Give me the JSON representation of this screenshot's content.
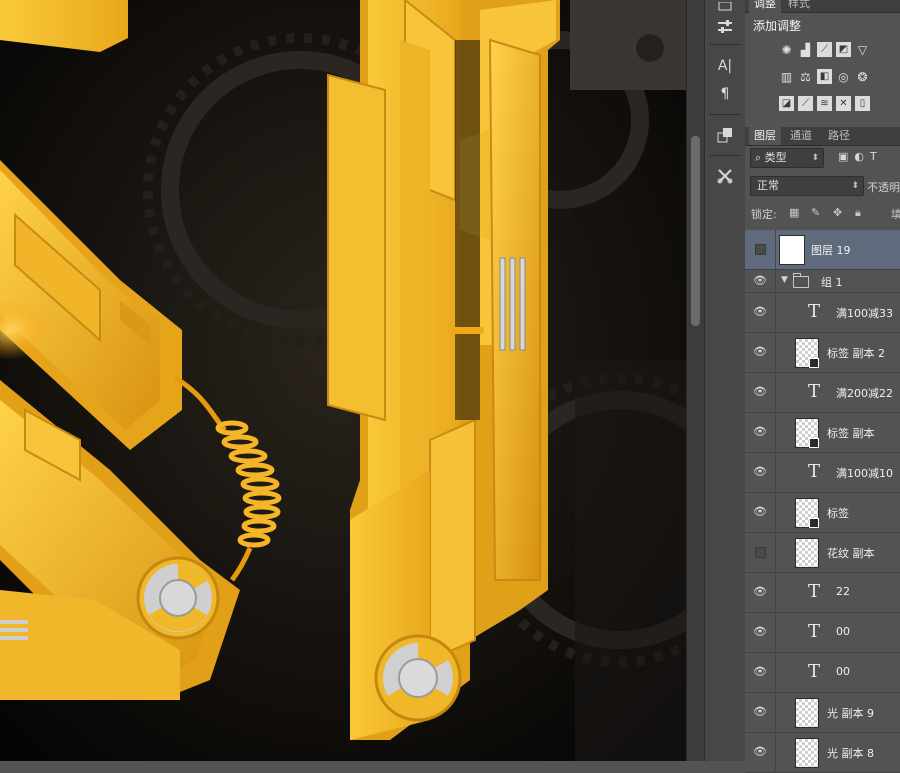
{
  "adjust_panel": {
    "tabs": [
      {
        "label": "调整",
        "active": true
      },
      {
        "label": "样式",
        "active": false
      }
    ],
    "title": "添加调整",
    "rows": [
      [
        "brightness-contrast-icon",
        "levels-icon",
        "curves-icon",
        "exposure-icon",
        "vibrance-icon"
      ],
      [
        "hue-saturation-icon",
        "color-balance-icon",
        "black-white-icon",
        "photo-filter-icon",
        "channel-mixer-icon"
      ],
      [
        "invert-icon",
        "posterize-icon",
        "threshold-icon",
        "gradient-map-icon",
        "selective-color-icon"
      ]
    ]
  },
  "layers_panel": {
    "tabs": [
      {
        "label": "图层",
        "active": true
      },
      {
        "label": "通道",
        "active": false
      },
      {
        "label": "路径",
        "active": false
      }
    ],
    "filter_kind": "类型",
    "filter_icons": [
      "image-filter-icon",
      "adjustment-filter-icon",
      "text-filter-icon"
    ],
    "filter_text_icon": "T",
    "blend_mode": "正常",
    "opacity_label": "不透明",
    "lock_label": "锁定:",
    "layers": [
      {
        "name": "图层 19",
        "kind": "pixel-white",
        "visible": false,
        "selected": true
      },
      {
        "name": "组 1",
        "kind": "group",
        "visible": true,
        "selected": false
      },
      {
        "name": "满100减33",
        "kind": "text",
        "visible": true
      },
      {
        "name": "标签 副本 2",
        "kind": "smart",
        "visible": true
      },
      {
        "name": "满200减22",
        "kind": "text",
        "visible": true
      },
      {
        "name": "标签 副本",
        "kind": "smart",
        "visible": true
      },
      {
        "name": "满100减10",
        "kind": "text",
        "visible": true
      },
      {
        "name": "标签",
        "kind": "smart",
        "visible": true
      },
      {
        "name": "花纹 副本",
        "kind": "pixel",
        "visible": false
      },
      {
        "name": "22",
        "kind": "text",
        "visible": true
      },
      {
        "name": "00",
        "kind": "text",
        "visible": true
      },
      {
        "name": "00",
        "kind": "text",
        "visible": true
      },
      {
        "name": "光 副本 9",
        "kind": "pixel",
        "visible": true
      },
      {
        "name": "光 副本 8",
        "kind": "pixel",
        "visible": true
      }
    ]
  },
  "toolstrip": {
    "tools": [
      "history-icon",
      "properties-icon",
      "character-icon",
      "paragraph-icon",
      "clone-source-icon",
      "tool-presets-icon"
    ],
    "glyphs": {
      "character": "A|",
      "paragraph": "¶"
    }
  },
  "colors": {
    "gold": "#f6c12f",
    "gold_dark": "#c9870d",
    "canvas_bg": "#0a0806",
    "panel_bg": "#535353",
    "selected_layer": "#5f6b7d"
  }
}
